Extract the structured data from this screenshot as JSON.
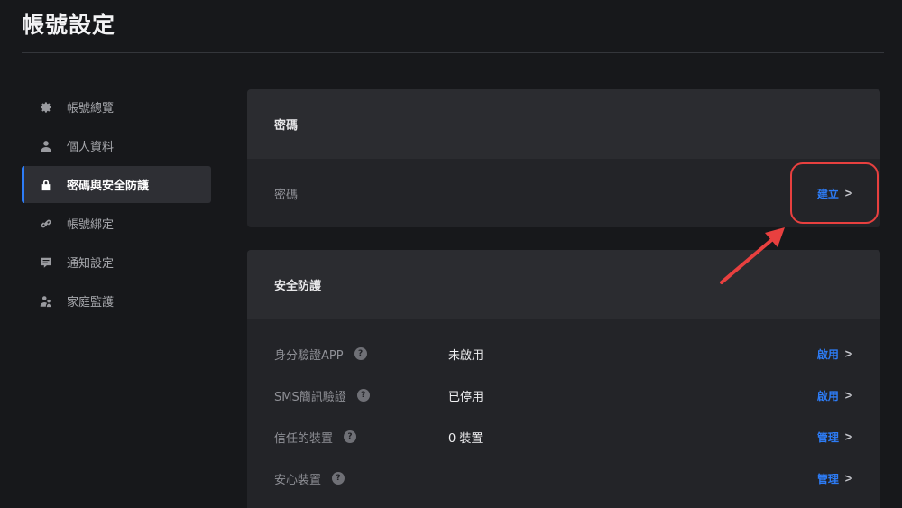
{
  "page": {
    "title": "帳號設定"
  },
  "sidebar": {
    "items": [
      {
        "label": "帳號總覽",
        "icon": "gear-icon"
      },
      {
        "label": "個人資料",
        "icon": "user-icon"
      },
      {
        "label": "密碼與安全防護",
        "icon": "lock-icon",
        "active": true
      },
      {
        "label": "帳號綁定",
        "icon": "link-icon"
      },
      {
        "label": "通知設定",
        "icon": "message-icon"
      },
      {
        "label": "家庭監護",
        "icon": "family-icon"
      }
    ]
  },
  "password_card": {
    "header": "密碼",
    "row": {
      "label": "密碼",
      "action": "建立"
    }
  },
  "security_card": {
    "header": "安全防護",
    "rows": [
      {
        "label": "身分驗證APP",
        "help": "?",
        "value": "未啟用",
        "action": "啟用"
      },
      {
        "label": "SMS簡訊驗證",
        "help": "?",
        "value": "已停用",
        "action": "啟用"
      },
      {
        "label": "信任的裝置",
        "help": "?",
        "value": "0 裝置",
        "action": "管理"
      },
      {
        "label": "安心裝置",
        "help": "?",
        "value": "",
        "action": "管理"
      }
    ]
  },
  "colors": {
    "background": "#17181b",
    "accent": "#2d7cf6",
    "annotation": "#e8403f"
  }
}
